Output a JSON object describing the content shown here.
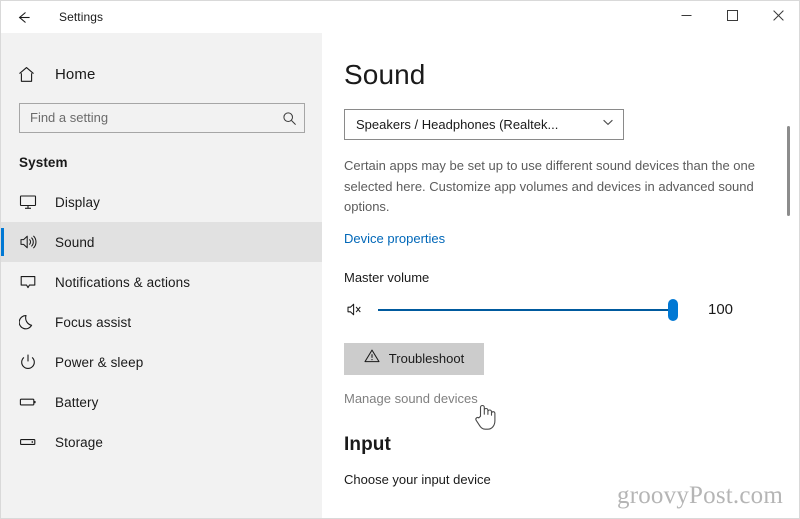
{
  "titlebar": {
    "back_icon": "back-arrow-icon",
    "title": "Settings",
    "minimize_label": "Minimize",
    "maximize_label": "Maximize",
    "close_label": "Close"
  },
  "sidebar": {
    "home": {
      "icon": "home-icon",
      "label": "Home"
    },
    "search": {
      "placeholder": "Find a setting",
      "value": "",
      "icon": "search-icon"
    },
    "section_title": "System",
    "items": [
      {
        "label": "Display",
        "icon": "monitor-icon",
        "selected": false
      },
      {
        "label": "Sound",
        "icon": "speaker-icon",
        "selected": true
      },
      {
        "label": "Notifications & actions",
        "icon": "notification-icon",
        "selected": false
      },
      {
        "label": "Focus assist",
        "icon": "moon-icon",
        "selected": false
      },
      {
        "label": "Power & sleep",
        "icon": "power-icon",
        "selected": false
      },
      {
        "label": "Battery",
        "icon": "battery-icon",
        "selected": false
      },
      {
        "label": "Storage",
        "icon": "storage-icon",
        "selected": false
      }
    ]
  },
  "main": {
    "page_title": "Sound",
    "output_device": {
      "value": "Speakers / Headphones (Realtek...",
      "chevron_icon": "chevron-down-icon"
    },
    "description": "Certain apps may be set up to use different sound devices than the one selected here. Customize app volumes and devices in advanced sound options.",
    "device_properties_link": "Device properties",
    "master_volume_label": "Master volume",
    "volume": {
      "value": "100",
      "percent": 100,
      "mute_icon": "speaker-mute-icon"
    },
    "troubleshoot_button": {
      "label": "Troubleshoot",
      "icon": "warning-triangle-icon"
    },
    "manage_sound_devices_link": "Manage sound devices",
    "input_section_title": "Input",
    "choose_input_label": "Choose your input device"
  },
  "watermark": "groovyPost.com",
  "colors": {
    "accent": "#0078d4",
    "link": "#0067b8",
    "sidebar_bg": "#f2f2f2",
    "button_bg": "#cccccc",
    "slider_fill": "#005a9e"
  }
}
